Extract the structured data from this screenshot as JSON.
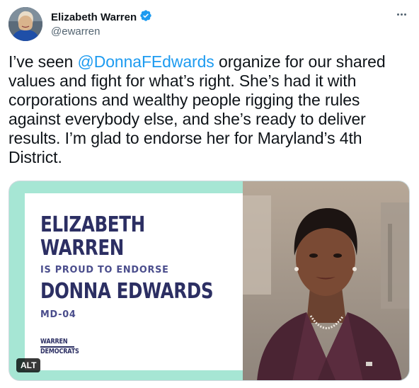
{
  "author": {
    "display_name": "Elizabeth Warren",
    "handle": "@ewarren",
    "verified": true,
    "avatar_icon": "profile-photo"
  },
  "menu": {
    "more_icon": "more-horizontal-icon"
  },
  "tweet": {
    "text_before": "I’ve seen ",
    "mention": "@DonnaFEdwards",
    "text_after": " organize for our shared values and fight for what’s right. She’s had it with corporations and wealthy people rigging the rules against everybody else, and she’s ready to deliver results. I’m glad to endorse her for Maryland’s 4th District."
  },
  "media": {
    "graphic": {
      "line1": "ELIZABETH",
      "line2": "WARREN",
      "line3": "IS PROUD TO ENDORSE",
      "line4": "DONNA EDWARDS",
      "line5": "MD-04",
      "logo_line1": "WARREN",
      "logo_line2": "DEMOCRATS"
    },
    "alt_label": "ALT"
  },
  "colors": {
    "accent": "#1d9bf0",
    "graphic_mint": "#a6e6d4",
    "graphic_navy": "#2c2f63",
    "photo_jacket": "#4a2433"
  }
}
